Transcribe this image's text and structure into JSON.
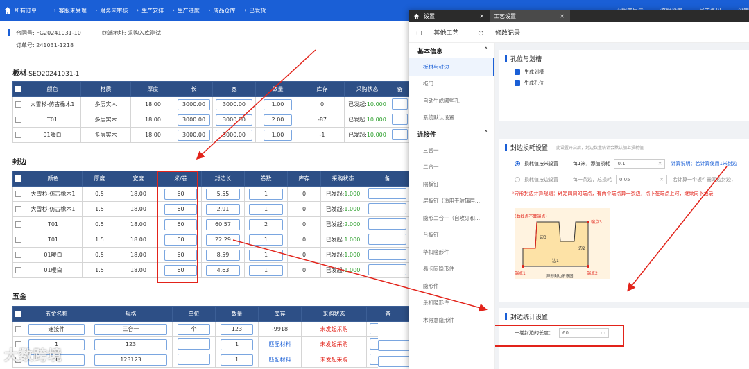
{
  "topbar": {
    "steps": [
      "所有订单",
      "客服未受理",
      "财务未审核",
      "生产安排",
      "生产进度",
      "成品仓库",
      "已发货"
    ],
    "arrow": "····›",
    "right": [
      "小程序显示",
      "流程设置",
      "员工条码",
      "设置"
    ]
  },
  "info": {
    "contract_label": "合同号:",
    "contract": "FG20241031-10",
    "address_label": "终端地址:",
    "address": "采购入库测试",
    "order_label": "订单号:",
    "order": "241031-1218"
  },
  "board": {
    "title": "板材",
    "code": "-SEO20241031-1",
    "headers": [
      "颜色",
      "材质",
      "厚度",
      "长",
      "宽",
      "数量",
      "库存",
      "采购状态",
      "备"
    ],
    "rows": [
      {
        "color": "大雪杉-仿古橡木1",
        "material": "多层实木",
        "thickness": "18.00",
        "length": "3000.00",
        "width": "3000.00",
        "qty": "1.00",
        "stock": "0",
        "status": "已发起:",
        "status_val": "10.000"
      },
      {
        "color": "T01",
        "material": "多层实木",
        "thickness": "18.00",
        "length": "3000.00",
        "width": "3000.00",
        "qty": "2.00",
        "stock": "-87",
        "status": "已发起:",
        "status_val": "10.000"
      },
      {
        "color": "01暖白",
        "material": "多层实木",
        "thickness": "18.00",
        "length": "3000.00",
        "width": "3000.00",
        "qty": "1.00",
        "stock": "-1",
        "status": "已发起:",
        "status_val": "10.000"
      }
    ]
  },
  "edge": {
    "title": "封边",
    "headers": [
      "颜色",
      "厚度",
      "宽度",
      "米/卷",
      "封边长",
      "卷数",
      "库存",
      "采购状态",
      "备"
    ],
    "rows": [
      {
        "color": "大雪杉-仿古橡木1",
        "thickness": "0.5",
        "width": "18.00",
        "mroll": "60",
        "elen": "5.55",
        "rolls": "1",
        "stock": "0",
        "status": "已发起:",
        "status_val": "1.000"
      },
      {
        "color": "大雪杉-仿古橡木1",
        "thickness": "1.5",
        "width": "18.00",
        "mroll": "60",
        "elen": "2.91",
        "rolls": "1",
        "stock": "0",
        "status": "已发起:",
        "status_val": "1.000"
      },
      {
        "color": "T01",
        "thickness": "0.5",
        "width": "18.00",
        "mroll": "60",
        "elen": "60.57",
        "rolls": "2",
        "stock": "0",
        "status": "已发起:",
        "status_val": "2.000"
      },
      {
        "color": "T01",
        "thickness": "1.5",
        "width": "18.00",
        "mroll": "60",
        "elen": "22.29",
        "rolls": "1",
        "stock": "0",
        "status": "已发起:",
        "status_val": "1.000"
      },
      {
        "color": "01暖白",
        "thickness": "0.5",
        "width": "18.00",
        "mroll": "60",
        "elen": "8.59",
        "rolls": "1",
        "stock": "0",
        "status": "已发起:",
        "status_val": "1.000"
      },
      {
        "color": "01暖白",
        "thickness": "1.5",
        "width": "18.00",
        "mroll": "60",
        "elen": "4.63",
        "rolls": "1",
        "stock": "0",
        "status": "已发起:",
        "status_val": "1.000"
      }
    ]
  },
  "hw": {
    "title": "五金",
    "headers": [
      "五金名称",
      "规格",
      "单位",
      "数量",
      "库存",
      "采购状态",
      "备"
    ],
    "rows": [
      {
        "name": "连接件",
        "spec": "三合一",
        "unit": "个",
        "qty": "123",
        "stock": "-9918",
        "status": "未发起采购",
        "link": "",
        "add": "",
        "del": ""
      },
      {
        "name": "1",
        "spec": "123",
        "unit": "",
        "qty": "1",
        "stock": "",
        "status": "未发起采购",
        "link": "匹配材料",
        "add": "插入行",
        "del": "删除"
      },
      {
        "name": "1",
        "spec": "123123",
        "unit": "",
        "qty": "1",
        "stock": "",
        "status": "未发起采购",
        "link": "匹配材料",
        "add": "插入行",
        "del": "删除"
      }
    ]
  },
  "panel": {
    "tabs": [
      "设置",
      "工艺设置"
    ],
    "toolbar": [
      "其他工艺",
      "修改记录"
    ],
    "groups": [
      {
        "label": "基本信息",
        "items": [
          "板材与封边",
          "柜门",
          "自动生成哪些孔",
          "系统默认设置"
        ]
      },
      {
        "label": "连接件",
        "items": [
          "三合一",
          "二合一",
          "隔板钉",
          "层板钉（适用于玻璃层...",
          "隐形二合一（自攻牙和...",
          "台板钉",
          "华扣隐形件",
          "易卡固隐形件",
          "隐形件",
          "乐扣隐形件",
          "木得意隐形件"
        ]
      }
    ],
    "hole": {
      "title": "孔位与划槽",
      "opts": [
        "生成划槽",
        "生成孔位"
      ]
    },
    "loss": {
      "title": "封边损耗设置",
      "note": "此设置开启后，封边数量统计会默认加上损耗值",
      "opt1": "损耗值按米设置",
      "opt1_text": "每1米，添加损耗",
      "opt1_val": "0.1",
      "opt1_desc": "计算说明：若计算使用1米封边",
      "opt2": "损耗值按边设置",
      "opt2_text": "每一条边，总损耗",
      "opt2_val": "0.05",
      "opt2_desc": "若计算一个板件需四边封边，",
      "rule": "*异形封边计算规则：确定四周的端点，有两个端点算一条边，点下在端点上时，继续向下记录",
      "diag_top": "(曲线点不算端点)",
      "diag_caption": "异形封边示意图",
      "diag_labels": [
        "端点3",
        "端点1",
        "端点2",
        "边1",
        "边2",
        "边3"
      ]
    },
    "stat": {
      "title": "封边统计设置",
      "label": "一卷封边的长度：",
      "value": "60",
      "unit": "m"
    }
  },
  "watermark": "大数跨境"
}
